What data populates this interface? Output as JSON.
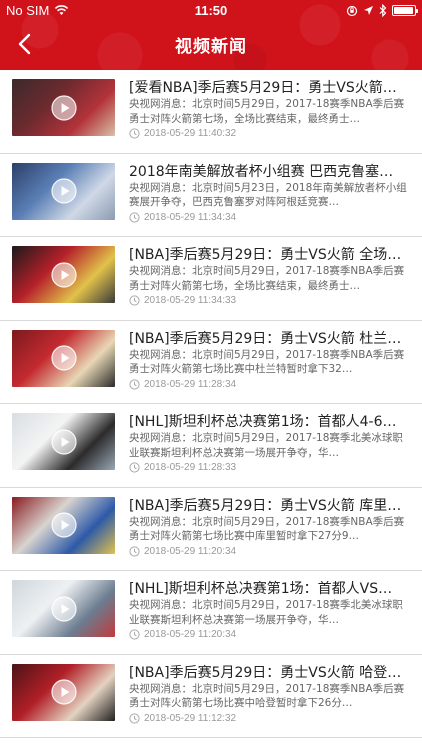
{
  "status": {
    "carrier": "No SIM",
    "time": "11:50",
    "battery_level": 0.95
  },
  "nav": {
    "title": "视频新闻",
    "back_icon": "chevron-left-icon"
  },
  "colors": {
    "brand_red": "#d0121b",
    "title": "#222222",
    "summary": "#666666",
    "timestamp": "#999999"
  },
  "items": [
    {
      "title": "[爱看NBA]季后赛5月29日：勇士VS火箭…",
      "summary": "央视网消息：北京时间5月29日，2017-18赛季NBA季后赛勇士对阵火箭第七场，全场比赛结束，最终勇士…",
      "time": "2018-05-29 11:40:32",
      "thumb_colors": [
        "#3a2a2a",
        "#6d2a2f",
        "#b3333a",
        "#d7c2a8"
      ]
    },
    {
      "title": "2018年南美解放者杯小组赛 巴西克鲁塞…",
      "summary": "央视网消息：北京时间5月23日，2018年南美解放者杯小组赛展开争夺，巴西克鲁塞罗对阵阿根廷竞赛…",
      "time": "2018-05-29 11:34:34",
      "thumb_colors": [
        "#2c3e6a",
        "#5a7fb5",
        "#cfd8e6",
        "#8a9bb0"
      ]
    },
    {
      "title": "[NBA]季后赛5月29日：勇士VS火箭 全场…",
      "summary": "央视网消息：北京时间5月29日，2017-18赛季NBA季后赛勇士对阵火箭第七场，全场比赛结束，最终勇士…",
      "time": "2018-05-29 11:34:33",
      "thumb_colors": [
        "#1a1a1a",
        "#b5202a",
        "#e1c24a",
        "#3a3a3a"
      ]
    },
    {
      "title": "[NBA]季后赛5月29日：勇士VS火箭 杜兰…",
      "summary": "央视网消息：北京时间5月29日，2017-18赛季NBA季后赛勇士对阵火箭第七场比赛中杜兰特暂时拿下32…",
      "time": "2018-05-29 11:28:34",
      "thumb_colors": [
        "#7a1a1e",
        "#c42a30",
        "#e8d7b5",
        "#2a2a2a"
      ]
    },
    {
      "title": "[NHL]斯坦利杯总决赛第1场：首都人4-6…",
      "summary": "央视网消息：北京时间5月29日，2017-18赛季北美冰球职业联赛斯坦利杯总决赛第一场展开争夺，华…",
      "time": "2018-05-29 11:28:33",
      "thumb_colors": [
        "#d9dee3",
        "#f4f4f4",
        "#2b2b2b",
        "#9aa7b5"
      ]
    },
    {
      "title": "[NBA]季后赛5月29日：勇士VS火箭 库里…",
      "summary": "央视网消息：北京时间5月29日，2017-18赛季NBA季后赛勇士对阵火箭第七场比赛中库里暂时拿下27分9…",
      "time": "2018-05-29 11:20:34",
      "thumb_colors": [
        "#8a1a20",
        "#d8d4cf",
        "#2e5aa8",
        "#e2c24d"
      ]
    },
    {
      "title": "[NHL]斯坦利杯总决赛第1场：首都人VS…",
      "summary": "央视网消息：北京时间5月29日，2017-18赛季北美冰球职业联赛斯坦利杯总决赛第一场展开争夺，华…",
      "time": "2018-05-29 11:20:34",
      "thumb_colors": [
        "#cfd6dc",
        "#eef1f3",
        "#6b7d90",
        "#c13a3a"
      ]
    },
    {
      "title": "[NBA]季后赛5月29日：勇士VS火箭 哈登…",
      "summary": "央视网消息：北京时间5月29日，2017-18赛季NBA季后赛勇士对阵火箭第七场比赛中哈登暂时拿下26分…",
      "time": "2018-05-29 11:12:32",
      "thumb_colors": [
        "#4a1416",
        "#b21f27",
        "#e3d2c0",
        "#1f1f1f"
      ]
    }
  ]
}
